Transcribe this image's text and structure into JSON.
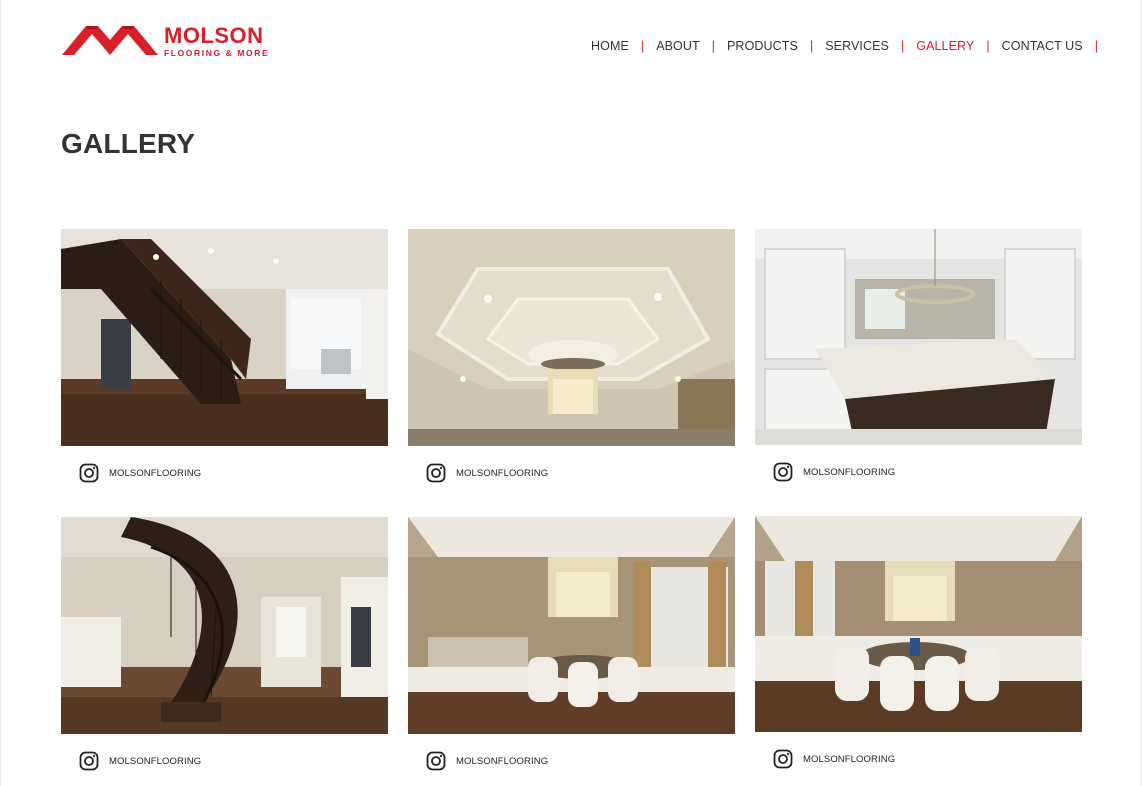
{
  "brand": {
    "name": "MOLSON",
    "tagline": "FLOORING & MORE",
    "accent_color": "#d7202a"
  },
  "nav": {
    "items": [
      {
        "label": "HOME",
        "active": false
      },
      {
        "label": "ABOUT",
        "active": false
      },
      {
        "label": "PRODUCTS",
        "active": false
      },
      {
        "label": "SERVICES",
        "active": false
      },
      {
        "label": "GALLERY",
        "active": true
      },
      {
        "label": "CONTACT US",
        "active": false
      }
    ],
    "separator": "|"
  },
  "page": {
    "title": "GALLERY"
  },
  "gallery": {
    "items": [
      {
        "subject": "staircase-foyer",
        "caption": "MOLSONFLOORING",
        "icon": "instagram-icon"
      },
      {
        "subject": "coffered-ceiling-chandelier",
        "caption": "MOLSONFLOORING",
        "icon": "instagram-icon"
      },
      {
        "subject": "white-kitchen-island",
        "caption": "MOLSONFLOORING",
        "icon": "instagram-icon"
      },
      {
        "subject": "curved-staircase-hallway",
        "caption": "MOLSONFLOORING",
        "icon": "instagram-icon"
      },
      {
        "subject": "dining-room-sideboard",
        "caption": "MOLSONFLOORING",
        "icon": "instagram-icon"
      },
      {
        "subject": "dining-room-round-table",
        "caption": "MOLSONFLOORING",
        "icon": "instagram-icon"
      }
    ]
  }
}
